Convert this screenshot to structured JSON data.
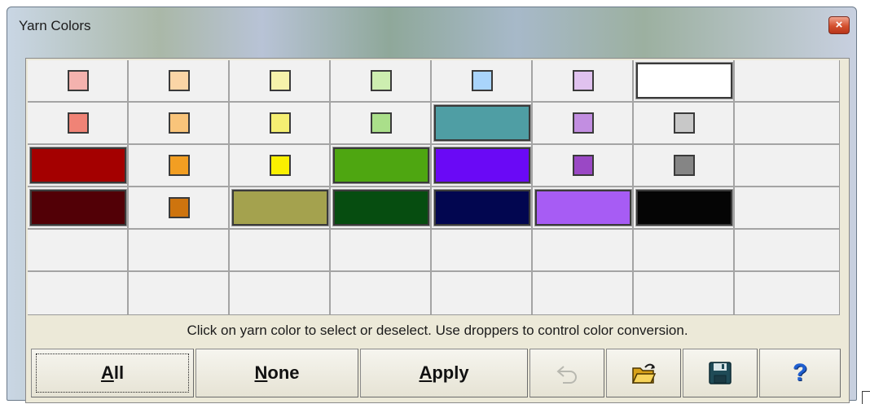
{
  "window": {
    "title": "Yarn Colors",
    "close_glyph": "×"
  },
  "palette": {
    "columns": 8,
    "rows": 6,
    "cells": [
      {
        "row": 0,
        "col": 0,
        "color": "#f4b2ae",
        "size": "small"
      },
      {
        "row": 0,
        "col": 1,
        "color": "#fbd5a6",
        "size": "small"
      },
      {
        "row": 0,
        "col": 2,
        "color": "#f6f2ab",
        "size": "small"
      },
      {
        "row": 0,
        "col": 3,
        "color": "#cdeeb0",
        "size": "small"
      },
      {
        "row": 0,
        "col": 4,
        "color": "#a9d4fb",
        "size": "small"
      },
      {
        "row": 0,
        "col": 5,
        "color": "#e0c2ef",
        "size": "small"
      },
      {
        "row": 0,
        "col": 6,
        "color": "#ffffff",
        "size": "large"
      },
      {
        "row": 1,
        "col": 0,
        "color": "#f08376",
        "size": "small"
      },
      {
        "row": 1,
        "col": 1,
        "color": "#f9c47a",
        "size": "small"
      },
      {
        "row": 1,
        "col": 2,
        "color": "#f5ef72",
        "size": "small"
      },
      {
        "row": 1,
        "col": 3,
        "color": "#aadf8a",
        "size": "small"
      },
      {
        "row": 1,
        "col": 4,
        "color": "#4f9ea4",
        "size": "large"
      },
      {
        "row": 1,
        "col": 5,
        "color": "#c28ee1",
        "size": "small"
      },
      {
        "row": 1,
        "col": 6,
        "color": "#c8c8c8",
        "size": "small"
      },
      {
        "row": 2,
        "col": 0,
        "color": "#a40000",
        "size": "large"
      },
      {
        "row": 2,
        "col": 1,
        "color": "#f29e22",
        "size": "small"
      },
      {
        "row": 2,
        "col": 2,
        "color": "#faf000",
        "size": "small"
      },
      {
        "row": 2,
        "col": 3,
        "color": "#4ea611",
        "size": "large"
      },
      {
        "row": 2,
        "col": 4,
        "color": "#6a09f6",
        "size": "large"
      },
      {
        "row": 2,
        "col": 5,
        "color": "#9a48c5",
        "size": "small"
      },
      {
        "row": 2,
        "col": 6,
        "color": "#858585",
        "size": "small"
      },
      {
        "row": 3,
        "col": 0,
        "color": "#520006",
        "size": "large"
      },
      {
        "row": 3,
        "col": 1,
        "color": "#ce740e",
        "size": "small"
      },
      {
        "row": 3,
        "col": 2,
        "color": "#a4a24e",
        "size": "large"
      },
      {
        "row": 3,
        "col": 3,
        "color": "#064d10",
        "size": "large"
      },
      {
        "row": 3,
        "col": 4,
        "color": "#020650",
        "size": "large"
      },
      {
        "row": 3,
        "col": 5,
        "color": "#a75cf4",
        "size": "large"
      },
      {
        "row": 3,
        "col": 6,
        "color": "#050505",
        "size": "large"
      }
    ]
  },
  "instructions": "Click on yarn color to select or deselect. Use droppers to control color conversion.",
  "buttons": {
    "all": {
      "mnemonic": "A",
      "rest": "ll"
    },
    "none": {
      "mnemonic": "N",
      "rest": "one"
    },
    "apply": {
      "mnemonic": "A",
      "rest": "pply"
    },
    "undo_icon": "undo-arrow-icon",
    "open_icon": "open-folder-icon",
    "save_icon": "floppy-disk-icon",
    "help_glyph": "?"
  }
}
